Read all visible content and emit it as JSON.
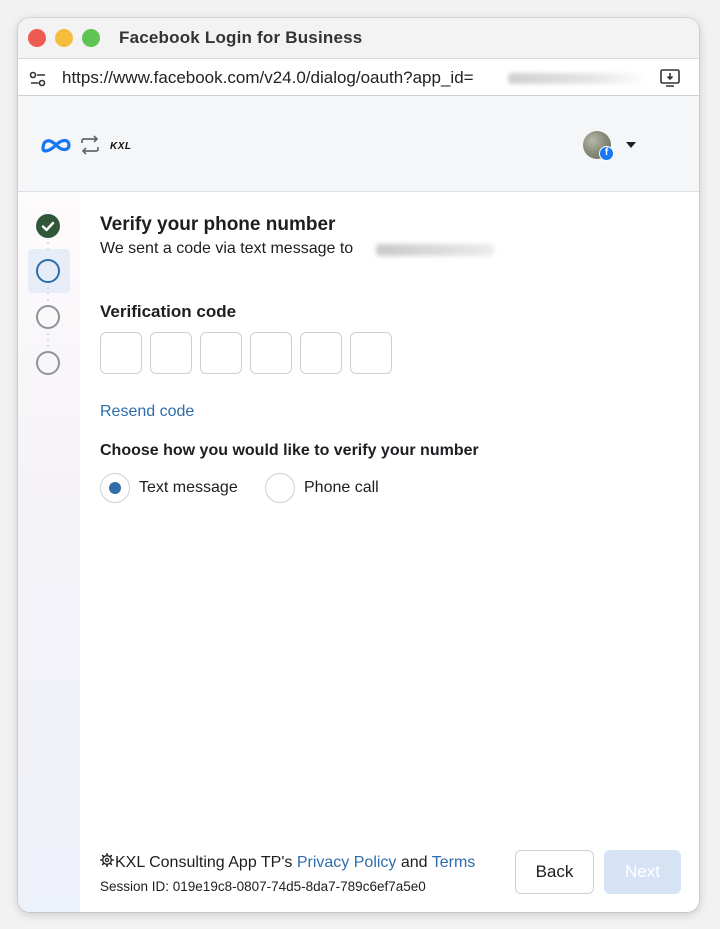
{
  "window": {
    "title": "Facebook Login for Business"
  },
  "browser": {
    "url": "https://www.facebook.com/v24.0/dialog/oauth?app_id="
  },
  "header": {
    "partner_logo": "KXL"
  },
  "stepper": {
    "steps": [
      "done",
      "current",
      "pending",
      "pending"
    ]
  },
  "main": {
    "title": "Verify your phone number",
    "subtitle": "We sent a code via text message to",
    "code_label": "Verification code",
    "code_values": [
      "",
      "",
      "",
      "",
      "",
      ""
    ],
    "resend_label": "Resend code",
    "choose_label": "Choose how you would like to verify your number",
    "options": [
      {
        "label": "Text message",
        "selected": true
      },
      {
        "label": "Phone call",
        "selected": false
      }
    ]
  },
  "footer": {
    "policy_prefix": "KXL Consulting App TP's",
    "privacy_link": "Privacy Policy",
    "and_text": "and",
    "terms_link": "Terms",
    "session": "Session ID: 019e19c8-0807-74d5-8da7-789c6ef7a5e0",
    "back_label": "Back",
    "next_label": "Next"
  },
  "colors": {
    "accent": "#2f6da8",
    "link": "#2e6dab",
    "done_step": "#31573b",
    "next_disabled": "#d5e3f4"
  },
  "icons": [
    "site-settings-icon",
    "cast-icon",
    "meta-logo-icon",
    "swap-arrows-icon",
    "facebook-badge-icon",
    "chevron-down-icon",
    "check-icon",
    "gear-icon"
  ]
}
